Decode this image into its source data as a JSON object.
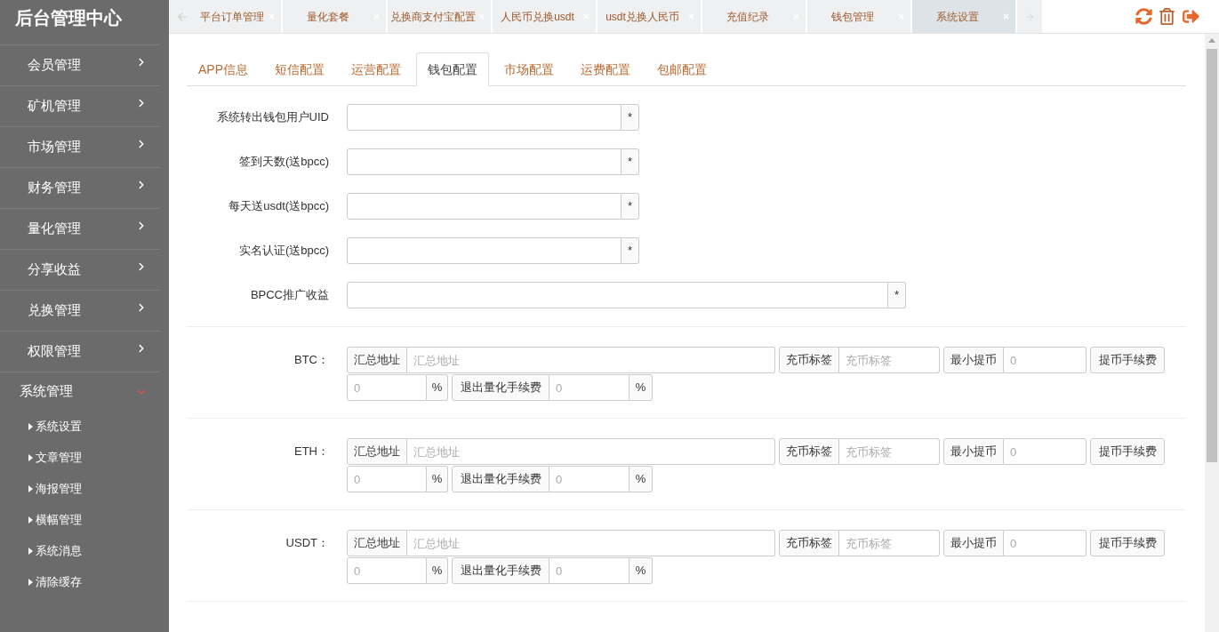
{
  "top_bar": {
    "tabs": [
      {
        "label": "平台订单管理",
        "selected": false
      },
      {
        "label": "量化套餐",
        "selected": false
      },
      {
        "label": "兑换商支付宝配置",
        "selected": false
      },
      {
        "label": "人民币兑换usdt",
        "selected": false
      },
      {
        "label": "usdt兑换人民币",
        "selected": false
      },
      {
        "label": "充值纪录",
        "selected": false
      },
      {
        "label": "钱包管理",
        "selected": false
      },
      {
        "label": "系统设置",
        "selected": true
      }
    ]
  },
  "sidebar": {
    "title": "后台管理中心",
    "items": [
      {
        "label": "会员管理",
        "expanded": false
      },
      {
        "label": "矿机管理",
        "expanded": false
      },
      {
        "label": "市场管理",
        "expanded": false
      },
      {
        "label": "财务管理",
        "expanded": false
      },
      {
        "label": "量化管理",
        "expanded": false
      },
      {
        "label": "分享收益",
        "expanded": false
      },
      {
        "label": "兑换管理",
        "expanded": false
      },
      {
        "label": "权限管理",
        "expanded": false
      },
      {
        "label": "系统管理",
        "expanded": true,
        "children": [
          {
            "label": "系统设置"
          },
          {
            "label": "文章管理"
          },
          {
            "label": "海报管理"
          },
          {
            "label": "横幅管理"
          },
          {
            "label": "系统消息"
          },
          {
            "label": "清除缓存"
          }
        ]
      }
    ]
  },
  "tabs": [
    {
      "label": "APP信息",
      "selected": false
    },
    {
      "label": "短信配置",
      "selected": false
    },
    {
      "label": "运营配置",
      "selected": false
    },
    {
      "label": "钱包配置",
      "selected": true
    },
    {
      "label": "市场配置",
      "selected": false
    },
    {
      "label": "运费配置",
      "selected": false
    },
    {
      "label": "包邮配置",
      "selected": false
    }
  ],
  "fields": [
    {
      "label": "系统转出钱包用户UID",
      "addon": "*",
      "kind": "short"
    },
    {
      "label": "签到天数(送bpcc)",
      "addon": "*",
      "kind": "short"
    },
    {
      "label": "每天送usdt(送bpcc)",
      "addon": "*",
      "kind": "short"
    },
    {
      "label": "实名认证(送bpcc)",
      "addon": "*",
      "kind": "short"
    },
    {
      "label": "BPCC推广收益",
      "addon": "*",
      "kind": "long"
    }
  ],
  "coins": [
    {
      "label": "BTC：",
      "address_addon": "汇总地址",
      "address_placeholder": "汇总地址",
      "tag_addon": "充币标签",
      "tag_placeholder": "充币标签",
      "min_addon": "最小提币",
      "min_placeholder": "0",
      "fee_addon": "提币手续费",
      "fee_placeholder": "0",
      "fee_unit": "%",
      "exit_fee_addon": "退出量化手续费",
      "exit_fee_placeholder": "0",
      "exit_fee_unit": "%"
    },
    {
      "label": "ETH：",
      "address_addon": "汇总地址",
      "address_placeholder": "汇总地址",
      "tag_addon": "充币标签",
      "tag_placeholder": "充币标签",
      "min_addon": "最小提币",
      "min_placeholder": "0",
      "fee_addon": "提币手续费",
      "fee_placeholder": "0",
      "fee_unit": "%",
      "exit_fee_addon": "退出量化手续费",
      "exit_fee_placeholder": "0",
      "exit_fee_unit": "%"
    },
    {
      "label": "USDT：",
      "address_addon": "汇总地址",
      "address_placeholder": "汇总地址",
      "tag_addon": "充币标签",
      "tag_placeholder": "充币标签",
      "min_addon": "最小提币",
      "min_placeholder": "0",
      "fee_addon": "提币手续费",
      "fee_placeholder": "0",
      "fee_unit": "%",
      "exit_fee_addon": "退出量化手续费",
      "exit_fee_placeholder": "0",
      "exit_fee_unit": "%"
    }
  ]
}
